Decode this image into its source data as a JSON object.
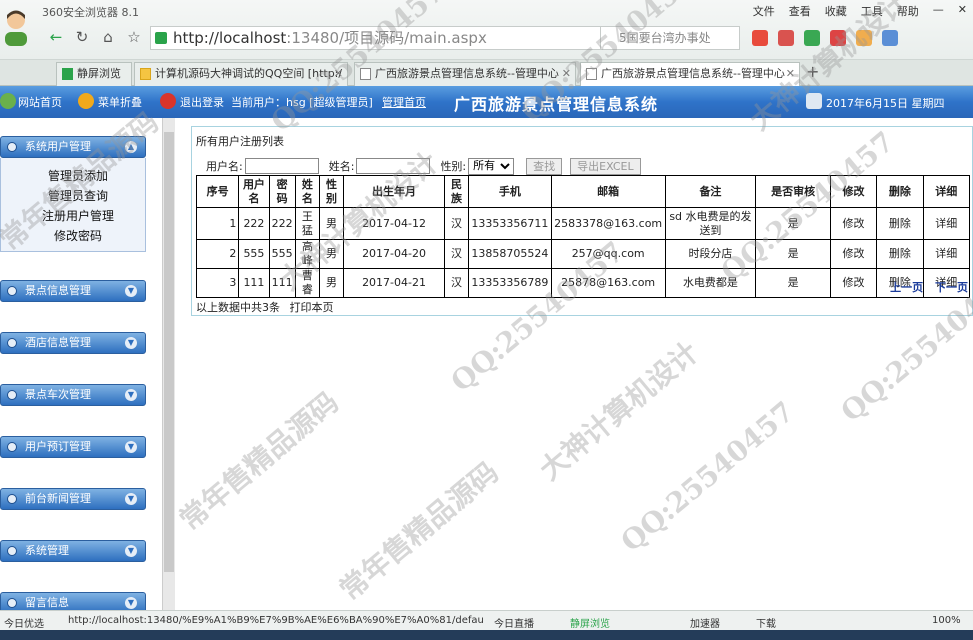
{
  "browser": {
    "title": "360安全浏览器 8.1",
    "menu": [
      "文件",
      "查看",
      "收藏",
      "工具",
      "帮助"
    ],
    "url_host": "http://localhost",
    "url_rest": ":13480/项目源码/main.aspx",
    "search_text": "5国要台湾办事处",
    "tabs": [
      {
        "label": "静屏浏览"
      },
      {
        "label": "计算机源码大神调试的QQ空间 [http:/"
      },
      {
        "label": "广西旅游景点管理信息系统--管理中心"
      },
      {
        "label": "广西旅游景点管理信息系统--管理中心"
      }
    ]
  },
  "header": {
    "home": "网站首页",
    "menu_fold": "菜单折叠",
    "logout": "退出登录",
    "current_user": "当前用户：hsg [超级管理员]",
    "admin_home": "管理首页",
    "title": "广西旅游景点管理信息系统",
    "date": "2017年6月15日 星期四"
  },
  "sidebar": {
    "sections": [
      {
        "label": "系统用户管理"
      },
      {
        "label": "景点信息管理"
      },
      {
        "label": "酒店信息管理"
      },
      {
        "label": "景点车次管理"
      },
      {
        "label": "用户预订管理"
      },
      {
        "label": "前台新闻管理"
      },
      {
        "label": "系统管理"
      },
      {
        "label": "留言信息"
      }
    ],
    "submenu": [
      "管理员添加",
      "管理员查询",
      "注册用户管理",
      "修改密码"
    ]
  },
  "main": {
    "panel_title": "所有用户注册列表",
    "filter": {
      "username_label": "用户名:",
      "name_label": "姓名:",
      "gender_label": "性别:",
      "gender_value": "所有",
      "search_button": "查找",
      "export_button": "导出EXCEL"
    },
    "columns": [
      "序号",
      "用户名",
      "密码",
      "姓名",
      "性别",
      "出生年月",
      "民族",
      "手机",
      "邮箱",
      "备注",
      "是否审核",
      "修改",
      "删除",
      "详细"
    ],
    "rows": [
      [
        "1",
        "222",
        "222",
        "王猛",
        "男",
        "2017-04-12",
        "汉",
        "13353356711",
        "2583378@163.com",
        "sd 水电费是的发送到",
        "是",
        "修改",
        "删除",
        "详细"
      ],
      [
        "2",
        "555",
        "555",
        "高峰",
        "男",
        "2017-04-20",
        "汉",
        "13858705524",
        "257@qq.com",
        "时段分店",
        "是",
        "修改",
        "删除",
        "详细"
      ],
      [
        "3",
        "111",
        "111",
        "曹睿",
        "男",
        "2017-04-21",
        "汉",
        "13353356789",
        "25878@163.com",
        "水电费都是",
        "是",
        "修改",
        "删除",
        "详细"
      ]
    ],
    "pager": {
      "prev": "上一页",
      "next": "下一页"
    },
    "footer_count": "以上数据中共3条",
    "footer_print": "打印本页"
  },
  "statusbar": {
    "today": "今日优选",
    "url": "http://localhost:13480/%E9%A1%B9%E7%9B%AE%E6%BA%90%E7%A0%81/defau",
    "live": "今日直播",
    "quiet": "静屏浏览",
    "accelerator": "加速器",
    "download": "下载",
    "zoom": "100%"
  },
  "watermarks": [
    "QQ:25540457",
    "常年售精品源码",
    "大神计算机设计",
    "QQ:25540457",
    "大神计算机设计",
    "QQ:25540457",
    "常年售精品源码",
    "QQ:25540457",
    "大神计算机设计",
    "QQ:25540457",
    "常年售精品源码",
    "QQ:25540457"
  ],
  "colors": {
    "header_blue": "#2f73c9",
    "panel_border": "#a8d3e0",
    "pager_blue": "#1a3b9b"
  }
}
